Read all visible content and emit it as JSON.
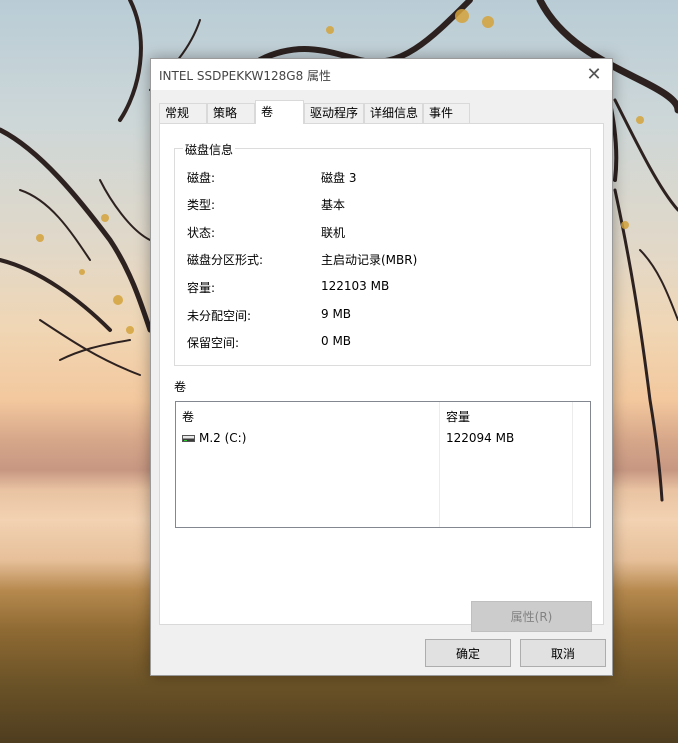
{
  "dialog": {
    "title": "INTEL SSDPEKKW128G8 属性",
    "close_glyph": "✕",
    "tabs": [
      "常规",
      "策略",
      "卷",
      "驱动程序",
      "详细信息",
      "事件"
    ],
    "active_tab": "卷"
  },
  "disk_info": {
    "legend": "磁盘信息",
    "rows": [
      {
        "label": "磁盘:",
        "value": "磁盘 3"
      },
      {
        "label": "类型:",
        "value": "基本"
      },
      {
        "label": "状态:",
        "value": "联机"
      },
      {
        "label": "磁盘分区形式:",
        "value": "主启动记录(MBR)"
      },
      {
        "label": "容量:",
        "value": "122103 MB"
      },
      {
        "label": "未分配空间:",
        "value": "9 MB"
      },
      {
        "label": "保留空间:",
        "value": "0 MB"
      }
    ]
  },
  "volumes": {
    "title": "卷",
    "columns": [
      "卷",
      "容量"
    ],
    "rows": [
      {
        "name": "M.2 (C:)",
        "capacity": "122094 MB",
        "icon": "drive-icon"
      }
    ]
  },
  "buttons": {
    "properties": "属性(R)",
    "ok": "确定",
    "cancel": "取消"
  }
}
